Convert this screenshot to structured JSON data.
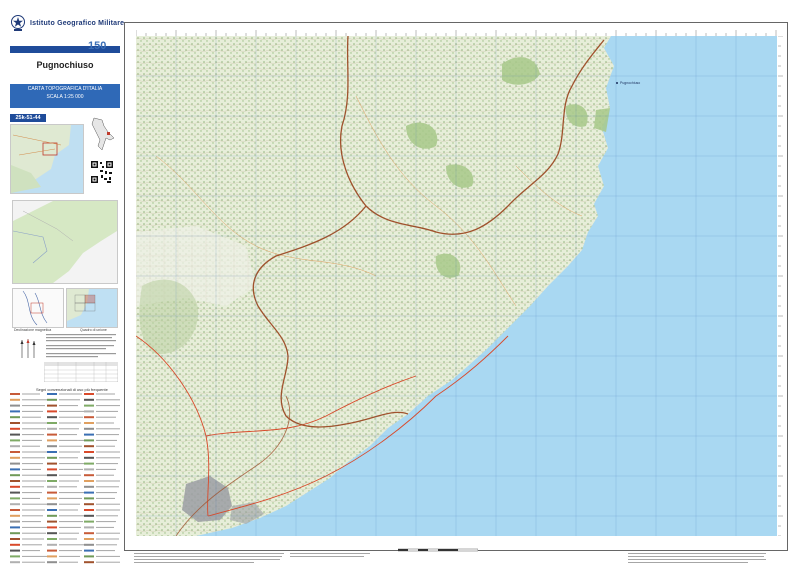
{
  "header": {
    "institute": "Istituto Geografico Militare",
    "anniversary_logo": "150",
    "sheet_name": "Pugnochiuso"
  },
  "series": {
    "title_line1": "CARTA TOPOGRAFICA D'ITALIA",
    "title_line2": "SCALA 1:25 000",
    "sheet_code": "25k-51-44"
  },
  "captions": {
    "declination": "Declinazione magnetica",
    "overview": "Quadro di unione",
    "legend_title": "Segni convenzionali di uso più frequente"
  },
  "map": {
    "sea_color": "#a9d8f2",
    "land_color": "#e7eed9",
    "forest_color": "#a8c98a",
    "boundary_color": "#a0522d",
    "town_color": "#9b9ea3",
    "place_labels": [
      "Pugnochiuso"
    ]
  },
  "colors": {
    "brand_blue": "#1f4c9a",
    "series_blue": "#2f69b7"
  }
}
